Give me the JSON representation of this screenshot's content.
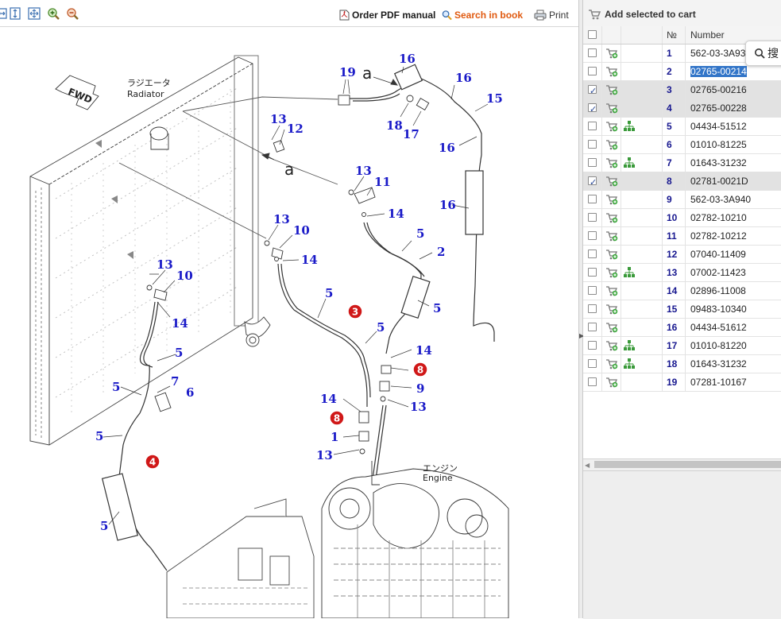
{
  "toolbar": {
    "pdf_label": "Order PDF manual",
    "search_label": "Search in book",
    "print_label": "Print"
  },
  "drawing": {
    "radiator_jp": "ラジエータ",
    "radiator_en": "Radiator",
    "fwd": "FWD",
    "engine_jp": "エンジン",
    "engine_en": "Engine",
    "ref_a1": "a",
    "ref_a2": "a",
    "callouts": {
      "c19": "19",
      "c16a": "16",
      "c16b": "16",
      "c15": "15",
      "c18": "18",
      "c17": "17",
      "c13a": "13",
      "c12": "12",
      "c16c": "16",
      "c13b": "13",
      "c11": "11",
      "c14a": "14",
      "c16d": "16",
      "c13c": "13",
      "c10a": "10",
      "c14b": "14",
      "c5a": "5",
      "c2": "2",
      "c13d": "13",
      "c10b": "10",
      "c5b": "5",
      "c14c": "14",
      "c5c": "5",
      "c5d": "5",
      "c5e": "5",
      "c14d": "14",
      "c9": "9",
      "c7": "7",
      "c5f": "5",
      "c6": "6",
      "c14e": "14",
      "c13e": "13",
      "c5g": "5",
      "c1": "1",
      "c13f": "13",
      "c5h": "5"
    },
    "badges": {
      "b3": "3",
      "b8a": "8",
      "b8b": "8",
      "b4": "4"
    }
  },
  "cart": {
    "add_label": "Add selected to cart"
  },
  "table": {
    "col_no": "№",
    "col_number": "Number",
    "rows": [
      {
        "no": "1",
        "number": "562-03-3A930",
        "checked": false,
        "tree": false
      },
      {
        "no": "2",
        "number": "02765-00214",
        "checked": false,
        "tree": false
      },
      {
        "no": "3",
        "number": "02765-00216",
        "checked": true,
        "tree": false
      },
      {
        "no": "4",
        "number": "02765-00228",
        "checked": true,
        "tree": false
      },
      {
        "no": "5",
        "number": "04434-51512",
        "checked": false,
        "tree": true
      },
      {
        "no": "6",
        "number": "01010-81225",
        "checked": false,
        "tree": false
      },
      {
        "no": "7",
        "number": "01643-31232",
        "checked": false,
        "tree": true
      },
      {
        "no": "8",
        "number": "02781-0021D",
        "checked": true,
        "tree": false
      },
      {
        "no": "9",
        "number": "562-03-3A940",
        "checked": false,
        "tree": false
      },
      {
        "no": "10",
        "number": "02782-10210",
        "checked": false,
        "tree": false
      },
      {
        "no": "11",
        "number": "02782-10212",
        "checked": false,
        "tree": false
      },
      {
        "no": "12",
        "number": "07040-11409",
        "checked": false,
        "tree": false
      },
      {
        "no": "13",
        "number": "07002-11423",
        "checked": false,
        "tree": true
      },
      {
        "no": "14",
        "number": "02896-11008",
        "checked": false,
        "tree": false
      },
      {
        "no": "15",
        "number": "09483-10340",
        "checked": false,
        "tree": false
      },
      {
        "no": "16",
        "number": "04434-51612",
        "checked": false,
        "tree": false
      },
      {
        "no": "17",
        "number": "01010-81220",
        "checked": false,
        "tree": true
      },
      {
        "no": "18",
        "number": "01643-31232",
        "checked": false,
        "tree": true
      },
      {
        "no": "19",
        "number": "07281-10167",
        "checked": false,
        "tree": false
      }
    ]
  },
  "popup": {
    "text": "搜"
  },
  "colors": {
    "callout": "#1a1ac8",
    "badge": "#d01818",
    "search_orange": "#e05a10",
    "selection_blue": "#3275c8"
  }
}
